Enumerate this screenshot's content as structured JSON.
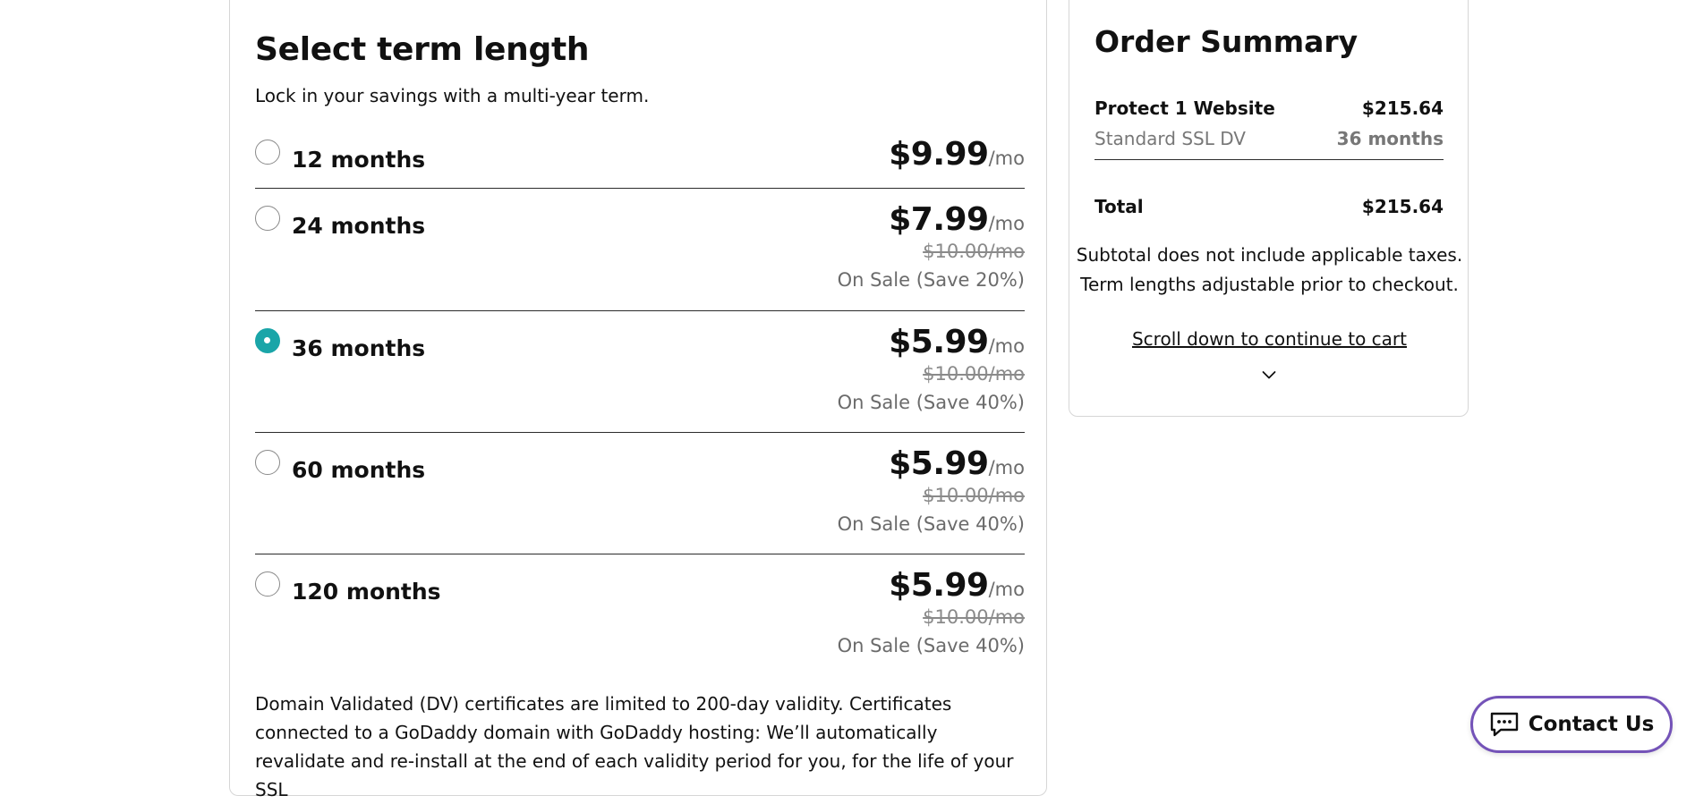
{
  "term": {
    "title": "Select term length",
    "subtitle": "Lock in your savings with a multi-year term.",
    "options": [
      {
        "label": "12 months",
        "price": "$9.99",
        "per": "/mo",
        "original": "",
        "sale": ""
      },
      {
        "label": "24 months",
        "price": "$7.99",
        "per": "/mo",
        "original": "$10.00/mo",
        "sale": "On Sale (Save 20%)"
      },
      {
        "label": "36 months",
        "price": "$5.99",
        "per": "/mo",
        "original": "$10.00/mo",
        "sale": "On Sale (Save 40%)"
      },
      {
        "label": "60 months",
        "price": "$5.99",
        "per": "/mo",
        "original": "$10.00/mo",
        "sale": "On Sale (Save 40%)"
      },
      {
        "label": "120 months",
        "price": "$5.99",
        "per": "/mo",
        "original": "$10.00/mo",
        "sale": "On Sale (Save 40%)"
      }
    ],
    "selected_option": "36 months",
    "accent_color": "#1aa5a8",
    "disclaimer": "Domain Validated (DV) certificates are limited to 200-day validity. Certificates connected to a GoDaddy domain with GoDaddy hosting: We’ll automatically revalidate and re-install at the end of each validity period for you, for the life of your SSL"
  },
  "summary": {
    "title": "Order Summary",
    "product_name": "Protect 1 Website",
    "product_price": "$215.64",
    "product_plan": "Standard SSL DV",
    "product_term": "36 months",
    "total_label": "Total",
    "total_value": "$215.64",
    "note_line1": "Subtotal does not include applicable taxes.",
    "note_line2": "Term lengths adjustable prior to checkout.",
    "scroll_link": "Scroll down to continue to cart",
    "chevron_icon": "chevron-down-icon"
  },
  "contact": {
    "label": "Contact Us",
    "icon": "chat-icon",
    "border_color": "#7453b8"
  }
}
